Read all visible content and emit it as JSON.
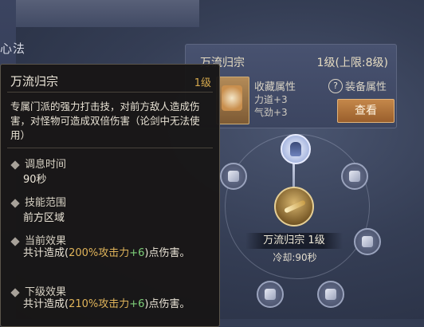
{
  "left_panel": {
    "title": "心法"
  },
  "right_panel": {
    "skill_name": "万流归宗",
    "level_text": "1级(上限:8级)",
    "attributes_title": "收藏属性",
    "attributes": [
      "力道+3",
      "气劲+3"
    ],
    "help_icon": "?",
    "equip_label": "装备属性",
    "view_button": "查看"
  },
  "wheel": {
    "selected_skill": "万流归宗 1级",
    "cooldown": "冷却:90秒"
  },
  "tooltip": {
    "title": "万流归宗",
    "level": "1级",
    "description": "专属门派的强力打击技，对前方敌人造成伤害，对怪物可造成双倍伤害（论剑中无法使用）",
    "sections": [
      {
        "label": "调息时间",
        "value": "90秒"
      },
      {
        "label": "技能范围",
        "value": "前方区域"
      }
    ],
    "current_effect": {
      "label": "当前效果",
      "prefix": "共计造成(",
      "pct": "200%攻击力",
      "bonus": "+6",
      "suffix": ")点伤害。"
    },
    "next_effect": {
      "label": "下级效果",
      "prefix": "共计造成(",
      "pct": "210%攻击力",
      "bonus": "+6",
      "suffix": ")点伤害。"
    }
  }
}
